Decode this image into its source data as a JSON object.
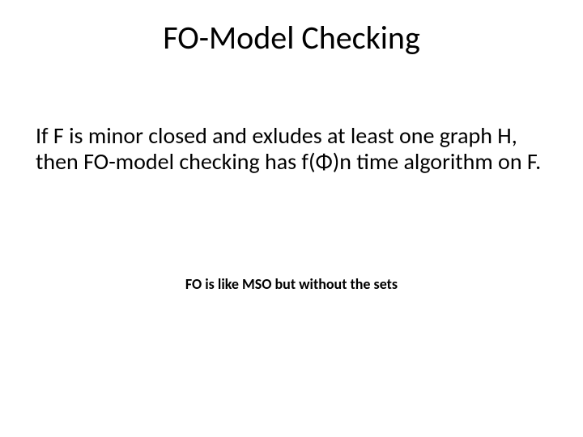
{
  "slide": {
    "title": "FO-Model Checking",
    "body": "If F is minor closed and exludes at least one graph H, then FO-model checking has f(Φ)n time algorithm on F.",
    "note": "FO is like MSO but without the sets"
  }
}
